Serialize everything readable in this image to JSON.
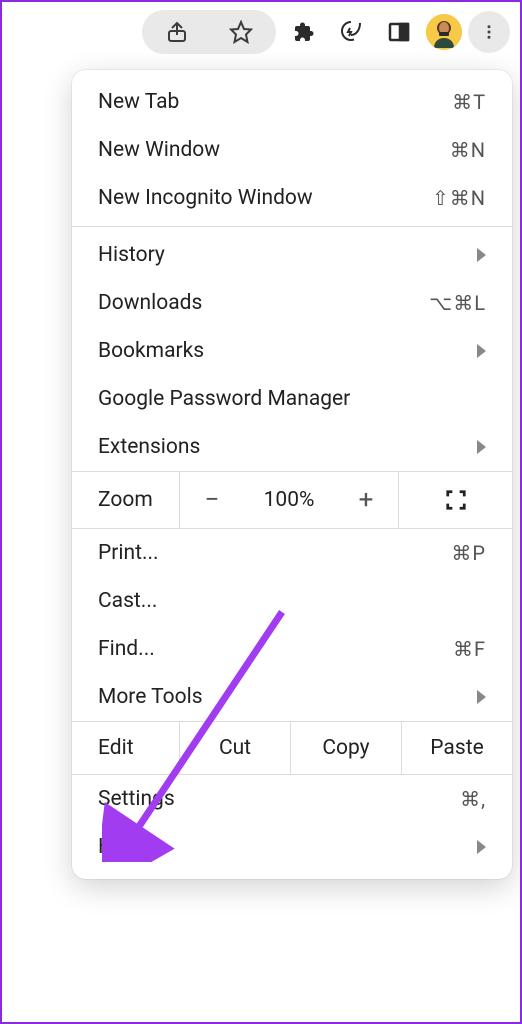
{
  "toolbar": {
    "share_icon": "share-icon",
    "star_icon": "star-icon",
    "extensions_icon": "puzzle-icon",
    "energy_icon": "leaf-bolt-icon",
    "panel_icon": "side-panel-icon",
    "avatar": "user-avatar",
    "kebab_icon": "more-icon"
  },
  "menu": {
    "new_tab": {
      "label": "New Tab",
      "accel": "⌘T"
    },
    "new_window": {
      "label": "New Window",
      "accel": "⌘N"
    },
    "new_incognito": {
      "label": "New Incognito Window",
      "accel": "⇧⌘N"
    },
    "history": {
      "label": "History"
    },
    "downloads": {
      "label": "Downloads",
      "accel": "⌥⌘L"
    },
    "bookmarks": {
      "label": "Bookmarks"
    },
    "password_manager": {
      "label": "Google Password Manager"
    },
    "extensions": {
      "label": "Extensions"
    },
    "zoom": {
      "label": "Zoom",
      "minus": "−",
      "pct": "100%",
      "plus": "+"
    },
    "print": {
      "label": "Print...",
      "accel": "⌘P"
    },
    "cast": {
      "label": "Cast..."
    },
    "find": {
      "label": "Find...",
      "accel": "⌘F"
    },
    "more_tools": {
      "label": "More Tools"
    },
    "edit": {
      "label": "Edit",
      "cut": "Cut",
      "copy": "Copy",
      "paste": "Paste"
    },
    "settings": {
      "label": "Settings",
      "accel": "⌘,"
    },
    "help": {
      "label": "Help"
    }
  },
  "annotation": {
    "arrow_color": "#a23cf0"
  }
}
